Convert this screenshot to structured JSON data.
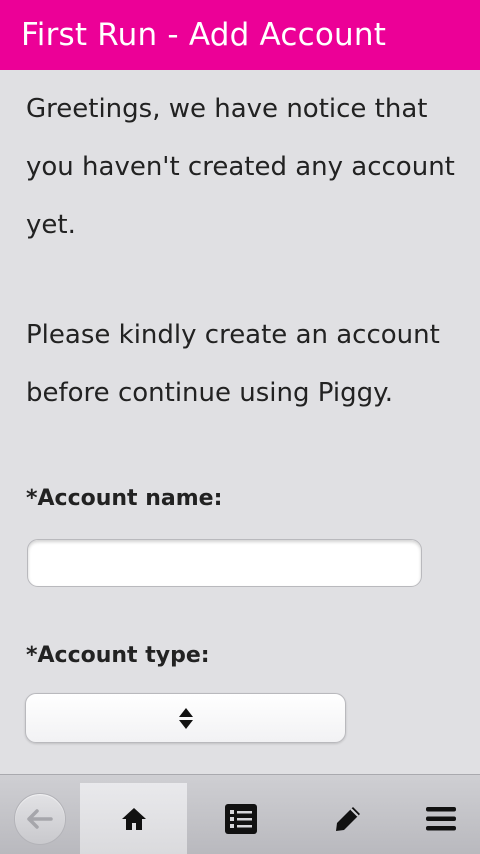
{
  "header": {
    "title": "First Run - Add Account"
  },
  "intro": {
    "paragraph1": "Greetings, we have notice that you haven't created any account yet.",
    "paragraph2": "Please kindly create an account before continue using Piggy."
  },
  "form": {
    "account_name_label": "*Account name:",
    "account_name_value": "",
    "account_type_label": "*Account type:",
    "account_type_value": ""
  },
  "toolbar": {
    "items": [
      {
        "icon": "back-arrow-icon",
        "enabled": false
      },
      {
        "icon": "home-icon",
        "selected": true
      },
      {
        "icon": "list-icon"
      },
      {
        "icon": "pencil-icon"
      },
      {
        "icon": "menu-icon"
      }
    ]
  },
  "colors": {
    "header_bg": "#ec0097",
    "page_bg": "#e0e0e3",
    "text": "#222222"
  }
}
